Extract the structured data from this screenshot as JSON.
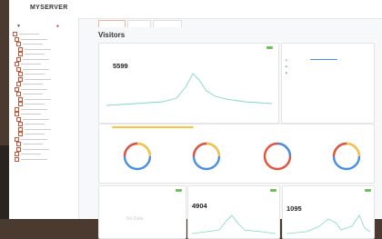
{
  "app": {
    "logo": "MYSERVER",
    "nav": [
      "",
      "",
      ""
    ]
  },
  "tabs": [],
  "page_title": "Visitors",
  "visitors_card": {
    "label": "",
    "value": "5599",
    "badge": ""
  },
  "section_cards": [
    {
      "label": ""
    },
    {
      "label": ""
    },
    {
      "label": ""
    },
    {
      "label": ""
    }
  ],
  "bottom_cards": [
    {
      "label": "",
      "value": "",
      "note": "No Data"
    },
    {
      "label": "",
      "value": "4904"
    },
    {
      "label": "",
      "value": "1095"
    }
  ],
  "colors": {
    "accent": "#f08c3c",
    "chart_line": "#7fd9c4",
    "blue": "#4a90e2",
    "red": "#e5533b",
    "yellow": "#f5c542",
    "green": "#6cbf5a"
  }
}
